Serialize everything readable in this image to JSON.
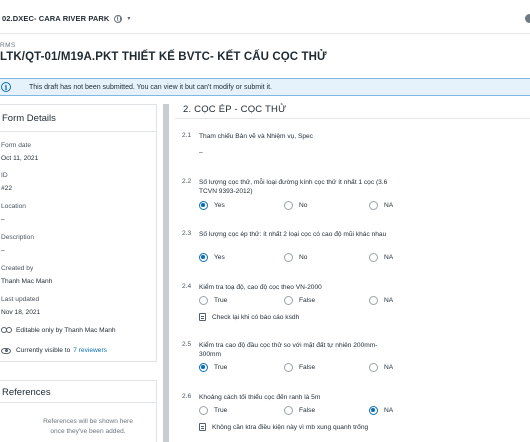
{
  "project": {
    "name": "02.DXEC- CARA RIVER PARK",
    "dropdown": "▾"
  },
  "header": {
    "breadcrumb": "RMS",
    "title": "LTK/QT-01/M19A.PKT THIẾT KẾ BVTC- KẾT CẤU CỌC THỬ"
  },
  "banner": {
    "icon": "info-icon",
    "text": "This draft has not been submitted. You can view it but can't modify or submit it."
  },
  "details": {
    "title": "Form Details",
    "date_label": "Form date",
    "date_value": "Oct 11, 2021",
    "id_label": "ID",
    "id_value": "#22",
    "location_label": "Location",
    "location_value": "–",
    "description_label": "Description",
    "description_value": "–",
    "created_label": "Created by",
    "created_value": "Thanh Mac Manh",
    "updated_label": "Last updated",
    "updated_value": "Nov 18, 2021",
    "editable_text": "Editable only by Thanh Mac Manh",
    "visible_prefix": "Currently visible to",
    "visible_link": "7 reviewers"
  },
  "references": {
    "title": "References",
    "empty_line1": "References will be shown here",
    "empty_line2": "once they've been added."
  },
  "form": {
    "section_title": "2. CỌC ÉP - CỌC THỬ",
    "questions": [
      {
        "num": "2.1",
        "text": "Tham chiếu Bản vẽ và Nhiệm vụ, Spec",
        "answer": "–"
      },
      {
        "num": "2.2",
        "text": "Số lượng cọc thử, mỗi loại đường kính cọc thử ít nhất 1 cọc (3.6 TCVN 9393-2012)",
        "options": [
          "Yes",
          "No",
          "NA"
        ],
        "selected": 0
      },
      {
        "num": "2.3",
        "text": "Số lượng cọc ép thử: ít nhất 2 loại cọc có cao độ mũi khác nhau",
        "options": [
          "Yes",
          "No",
          "NA"
        ],
        "selected": 0
      },
      {
        "num": "2.4",
        "text": "Kiểm tra toạ độ, cao độ cọc theo VN-2000",
        "options": [
          "True",
          "False",
          "NA"
        ],
        "selected": -1,
        "note": "Check lại khi có báo cáo ksdh"
      },
      {
        "num": "2.5",
        "text": "Kiểm tra cao độ đầu cọc thử so với mặt đất tự nhiên 200mm-300mm",
        "options": [
          "True",
          "False",
          "NA"
        ],
        "selected": 0
      },
      {
        "num": "2.6",
        "text": "Khoảng cách tối thiểu cọc đến ranh là 5m",
        "options": [
          "True",
          "False",
          "NA"
        ],
        "selected": 2,
        "note": "Không cần ktra điều kiện này vì mb xung quanh trống"
      }
    ]
  },
  "colors": {
    "accent": "#0d6fb8",
    "banner_bg": "#e6f2fb",
    "banner_border": "#7fb9e3"
  }
}
